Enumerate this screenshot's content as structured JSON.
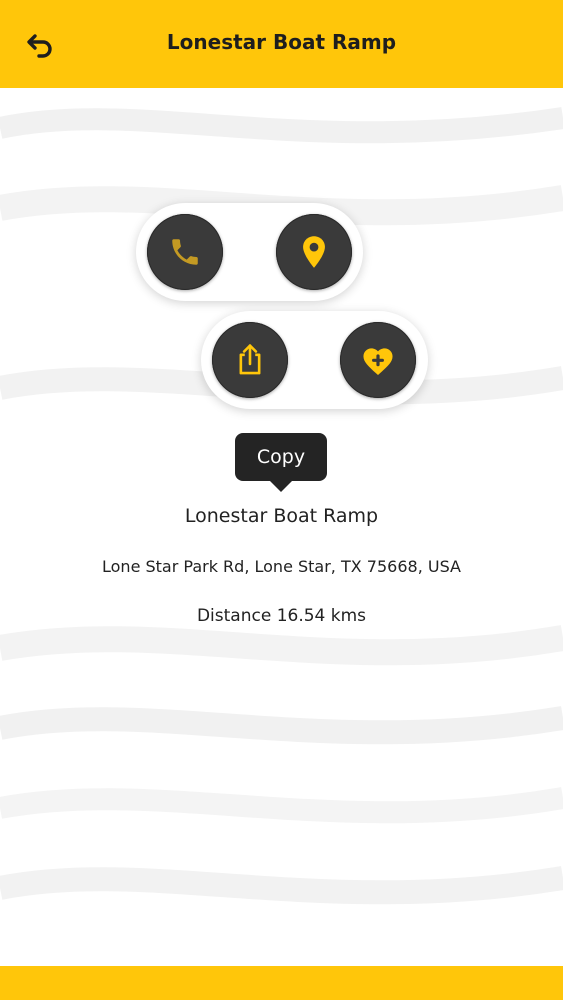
{
  "appbar": {
    "title": "Lonestar Boat Ramp",
    "back_icon": "back-arrow-icon"
  },
  "actions": {
    "call": {
      "icon": "phone-icon"
    },
    "location": {
      "icon": "location-pin-icon"
    },
    "share": {
      "icon": "share-icon"
    },
    "favorite": {
      "icon": "heart-plus-icon"
    }
  },
  "tooltip": {
    "label": "Copy"
  },
  "place": {
    "name": "Lonestar Boat Ramp",
    "address": "Lone Star Park Rd, Lone Star, TX 75668, USA",
    "distance": "Distance 16.54 kms"
  },
  "colors": {
    "accent": "#FFC60A",
    "button_bg": "#3a3a3a",
    "icon_gold": "#C49A23",
    "tooltip_bg": "#242424"
  }
}
